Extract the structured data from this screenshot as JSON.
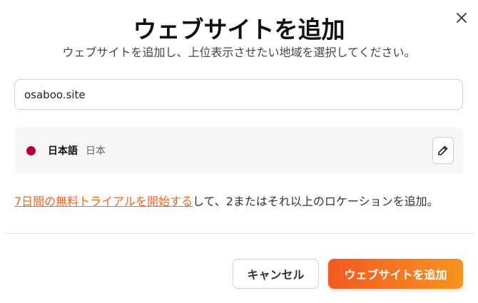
{
  "dialog": {
    "title": "ウェブサイトを追加",
    "subtitle": "ウェブサイトを追加し、上位表示させたい地域を選択してください。"
  },
  "website_input": {
    "value": "osaboo.site"
  },
  "location": {
    "flag_icon": "japan-flag-icon",
    "flag_color": "#bc002d",
    "language": "日本語",
    "region": "日本",
    "edit_icon": "pencil-icon"
  },
  "promo": {
    "link_text": "7日間の無料トライアルを開始する",
    "rest_text": "して、2またはそれ以上のロケーションを追加。",
    "link_color": "#f26522"
  },
  "actions": {
    "cancel_label": "キャンセル",
    "submit_label": "ウェブサイトを追加",
    "submit_gradient_start": "#f15a24",
    "submit_gradient_end": "#f7931e"
  },
  "close_icon": "close-icon"
}
